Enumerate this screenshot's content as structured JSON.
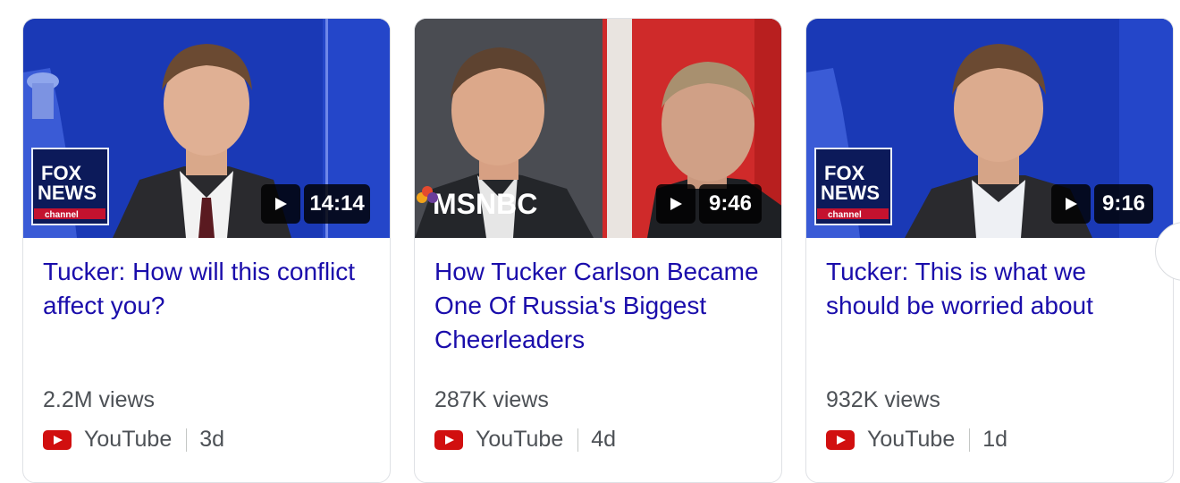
{
  "videos": [
    {
      "title": "Tucker: How will this conflict affect you?",
      "duration": "14:14",
      "views": "2.2M views",
      "source": "YouTube",
      "age": "3d",
      "channel_logo_line1": "FOX",
      "channel_logo_line2": "NEWS",
      "channel_logo_line3": "channel"
    },
    {
      "title": "How Tucker Carlson Became One Of Russia's Biggest Cheerleaders",
      "duration": "9:46",
      "views": "287K views",
      "source": "YouTube",
      "age": "4d",
      "channel_logo": "MSNBC"
    },
    {
      "title": "Tucker: This is what we should be worried about",
      "duration": "9:16",
      "views": "932K views",
      "source": "YouTube",
      "age": "1d",
      "channel_logo_line1": "FOX",
      "channel_logo_line2": "NEWS",
      "channel_logo_line3": "channel"
    }
  ],
  "icons": {
    "play": "play-icon",
    "source": "youtube-icon",
    "next": "next-arrow-icon"
  },
  "colors": {
    "title_link": "#1a0dab",
    "meta_text": "#4d5156",
    "youtube_red": "#ff0000"
  }
}
